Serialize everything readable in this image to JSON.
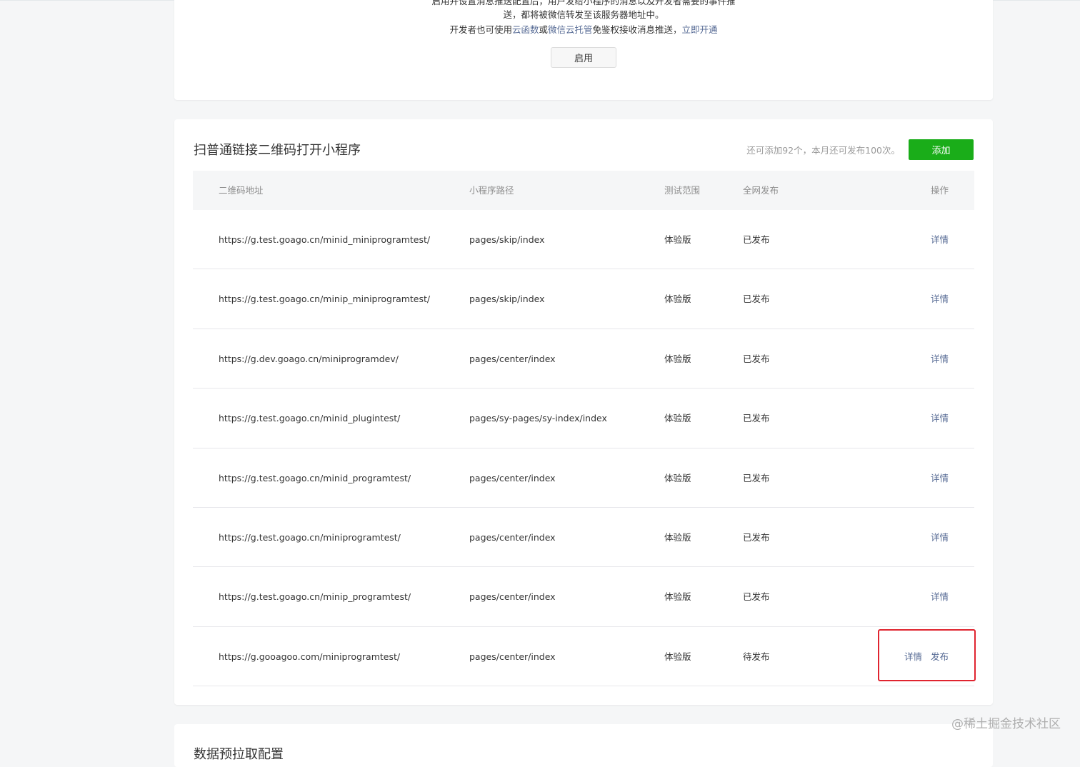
{
  "top_notice": {
    "line0": "启用并设置消息推送配置后，用户发给小程序的消息以及开发者需要的事件推",
    "line1": "送，都将被微信转发至该服务器地址中。",
    "line2_prefix": "开发者也可使用",
    "line2_link1": "云函数",
    "line2_mid": "或",
    "line2_link2": "微信云托管",
    "line2_suffix": "免鉴权接收消息推送，",
    "line2_link3": "立即开通",
    "enable_label": "启用"
  },
  "section": {
    "title": "扫普通链接二维码打开小程序",
    "quota": "还可添加92个，本月还可发布100次。",
    "add_label": "添加"
  },
  "table": {
    "columns": [
      "二维码地址",
      "小程序路径",
      "测试范围",
      "全网发布",
      "操作"
    ],
    "rows": [
      {
        "url": "https://g.test.goago.cn/minid_miniprogramtest/",
        "path": "pages/skip/index",
        "range": "体验版",
        "status": "已发布",
        "ops": [
          "详情"
        ]
      },
      {
        "url": "https://g.test.goago.cn/minip_miniprogramtest/",
        "path": "pages/skip/index",
        "range": "体验版",
        "status": "已发布",
        "ops": [
          "详情"
        ]
      },
      {
        "url": "https://g.dev.goago.cn/miniprogramdev/",
        "path": "pages/center/index",
        "range": "体验版",
        "status": "已发布",
        "ops": [
          "详情"
        ]
      },
      {
        "url": "https://g.test.goago.cn/minid_plugintest/",
        "path": "pages/sy-pages/sy-index/index",
        "range": "体验版",
        "status": "已发布",
        "ops": [
          "详情"
        ]
      },
      {
        "url": "https://g.test.goago.cn/minid_programtest/",
        "path": "pages/center/index",
        "range": "体验版",
        "status": "已发布",
        "ops": [
          "详情"
        ]
      },
      {
        "url": "https://g.test.goago.cn/miniprogramtest/",
        "path": "pages/center/index",
        "range": "体验版",
        "status": "已发布",
        "ops": [
          "详情"
        ]
      },
      {
        "url": "https://g.test.goago.cn/minip_programtest/",
        "path": "pages/center/index",
        "range": "体验版",
        "status": "已发布",
        "ops": [
          "详情"
        ]
      },
      {
        "url": "https://g.gooagoo.com/miniprogramtest/",
        "path": "pages/center/index",
        "range": "体验版",
        "status": "待发布",
        "ops": [
          "详情",
          "发布"
        ]
      }
    ]
  },
  "bottom_section": {
    "title": "数据预拉取配置"
  },
  "watermark": "@稀土掘金技术社区",
  "colors": {
    "primary_green": "#1aad19",
    "link_blue": "#576b95",
    "highlight_red": "#e0242f"
  }
}
